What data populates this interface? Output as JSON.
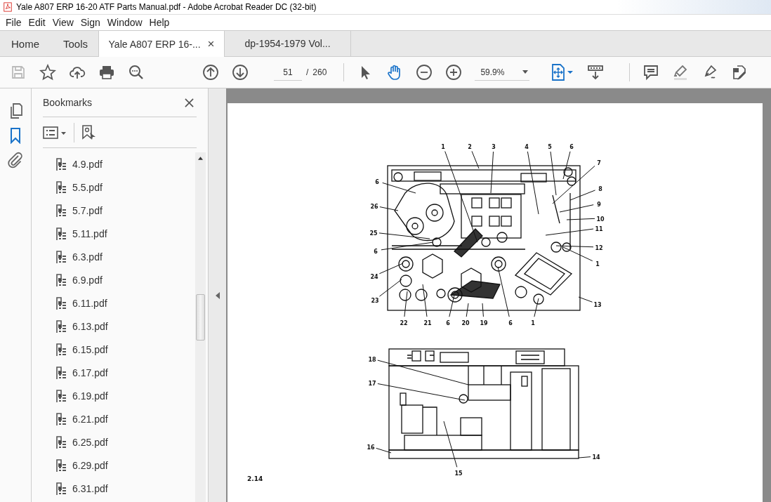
{
  "window": {
    "title": "Yale A807 ERP 16-20 ATF Parts Manual.pdf - Adobe Acrobat Reader DC (32-bit)"
  },
  "menu": [
    "File",
    "Edit",
    "View",
    "Sign",
    "Window",
    "Help"
  ],
  "tabs": [
    {
      "label": "Home",
      "kind": "nav",
      "selected": false
    },
    {
      "label": "Tools",
      "kind": "nav",
      "selected": false
    },
    {
      "label": "Yale A807 ERP 16-...",
      "kind": "document",
      "selected": true,
      "close": "×"
    },
    {
      "label": "dp-1954-1979 Vol...",
      "kind": "document",
      "selected": false
    }
  ],
  "toolbar": {
    "page_current": "51",
    "page_separator": "/",
    "page_total": "260",
    "zoom": "59.9%"
  },
  "rail": [
    {
      "kind": "pages",
      "selected": false
    },
    {
      "kind": "bookmarks",
      "selected": true
    },
    {
      "kind": "attachments",
      "selected": false
    }
  ],
  "bookmarks": {
    "title": "Bookmarks",
    "items": [
      "4.9.pdf",
      "5.5.pdf",
      "5.7.pdf",
      "5.11.pdf",
      "6.3.pdf",
      "6.9.pdf",
      "6.11.pdf",
      "6.13.pdf",
      "6.15.pdf",
      "6.17.pdf",
      "6.19.pdf",
      "6.21.pdf",
      "6.25.pdf",
      "6.29.pdf",
      "6.31.pdf"
    ]
  },
  "document": {
    "figure_label": "2.14",
    "top_view_callouts": [
      "1",
      "2",
      "3",
      "4",
      "5",
      "6",
      "7",
      "6",
      "8",
      "26",
      "9",
      "10",
      "25",
      "11",
      "6",
      "12",
      "1",
      "24",
      "23",
      "13",
      "22",
      "21",
      "6",
      "20",
      "19",
      "6",
      "1"
    ],
    "side_view_callouts": [
      "18",
      "17",
      "16",
      "15",
      "14"
    ]
  }
}
